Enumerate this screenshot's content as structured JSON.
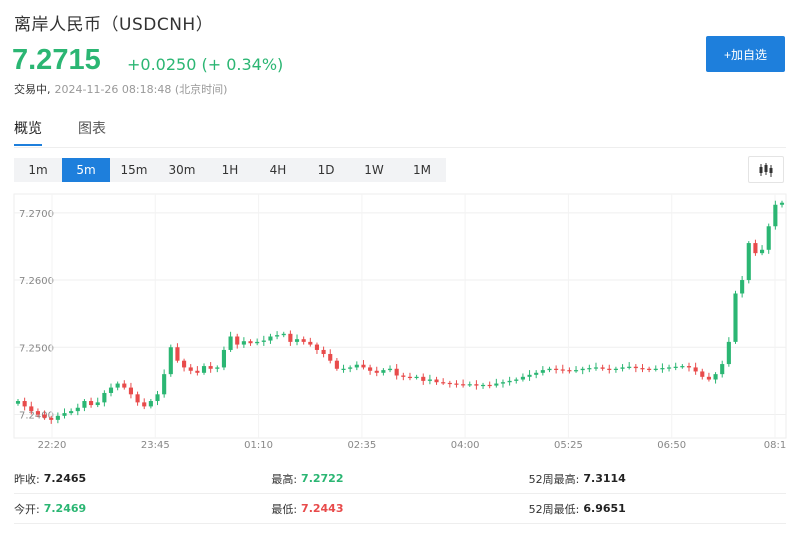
{
  "header": {
    "title": "离岸人民币（USDCNH）",
    "price": "7.2715",
    "change": "+0.0250 (+ 0.34%)",
    "status": "交易中,",
    "timestamp": "2024-11-26 08:18:48 (北京时间)",
    "add_label": "+加自选"
  },
  "tabs": [
    "概览",
    "图表"
  ],
  "periods": [
    "1m",
    "5m",
    "15m",
    "30m",
    "1H",
    "4H",
    "1D",
    "1W",
    "1M"
  ],
  "active_period": "5m",
  "colors": {
    "up": "#2bb673",
    "down": "#e84b4b",
    "accent": "#1e7fdc"
  },
  "chart_data": {
    "type": "candlestick",
    "y_ticks": [
      "7.2700",
      "7.2600",
      "7.2500",
      "7.2400"
    ],
    "x_ticks": [
      "22:20",
      "23:45",
      "01:10",
      "02:35",
      "04:00",
      "05:25",
      "06:50",
      "08:1"
    ],
    "ylim": [
      7.2365,
      7.2728
    ],
    "grid": true,
    "closes": [
      7.242,
      7.2412,
      7.2405,
      7.24,
      7.2395,
      7.2392,
      7.2398,
      7.2402,
      7.2405,
      7.241,
      7.242,
      7.2414,
      7.2418,
      7.2432,
      7.244,
      7.2446,
      7.244,
      7.243,
      7.2418,
      7.2412,
      7.242,
      7.243,
      7.246,
      7.25,
      7.248,
      7.247,
      7.2465,
      7.2462,
      7.2472,
      7.2468,
      7.247,
      7.2496,
      7.2516,
      7.2504,
      7.2509,
      7.2506,
      7.2508,
      7.251,
      7.2516,
      7.2518,
      7.252,
      7.2508,
      7.2512,
      7.2508,
      7.2504,
      7.2496,
      7.249,
      7.248,
      7.2468,
      7.2468,
      7.247,
      7.2474,
      7.247,
      7.2465,
      7.2462,
      7.2466,
      7.2468,
      7.2458,
      7.2456,
      7.2455,
      7.2456,
      7.245,
      7.2452,
      7.2448,
      7.2447,
      7.2446,
      7.2445,
      7.2444,
      7.2445,
      7.2443,
      7.2444,
      7.2443,
      7.2446,
      7.2448,
      7.245,
      7.2452,
      7.2456,
      7.2459,
      7.2462,
      7.2466,
      7.2468,
      7.2467,
      7.2466,
      7.2465,
      7.2466,
      7.2468,
      7.2469,
      7.247,
      7.2468,
      7.2467,
      7.2468,
      7.247,
      7.2471,
      7.2469,
      7.2468,
      7.2467,
      7.2468,
      7.2469,
      7.247,
      7.2471,
      7.2472,
      7.247,
      7.2464,
      7.2456,
      7.2452,
      7.246,
      7.2475,
      7.2508,
      7.258,
      7.26,
      7.2655,
      7.264,
      7.2645,
      7.268,
      7.2712,
      7.2715
    ]
  },
  "stats": [
    [
      {
        "label": "昨收:",
        "value": "7.2465"
      },
      {
        "label": "最高:",
        "value": "7.2722"
      },
      {
        "label": "52周最高:",
        "value": "7.3114"
      }
    ],
    [
      {
        "label": "今开:",
        "value": "7.2469"
      },
      {
        "label": "最低:",
        "value": "7.2443"
      },
      {
        "label": "52周最低:",
        "value": "6.9651"
      }
    ]
  ]
}
